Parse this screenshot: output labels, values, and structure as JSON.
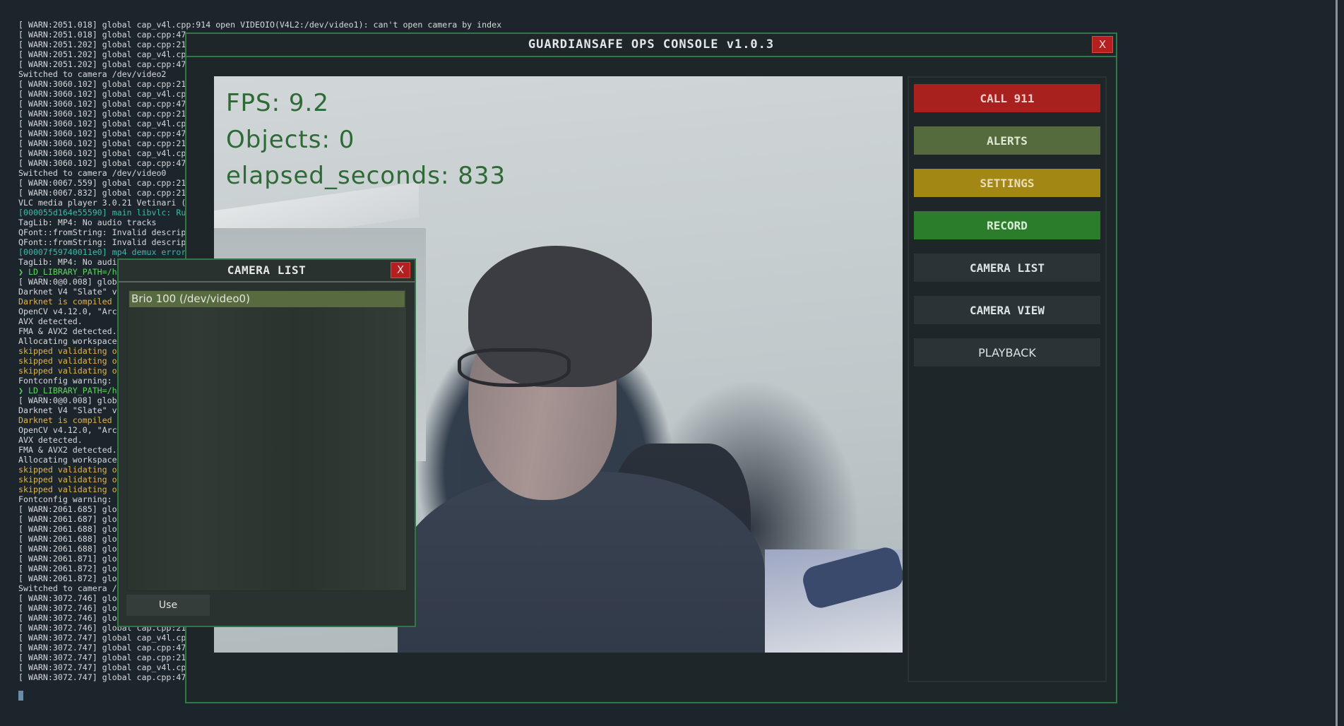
{
  "terminal": {
    "lines": [
      {
        "text": "[ WARN:2051.018] global cap_v4l.cpp:914 open VIDEOIO(V4L2:/dev/video1): can't open camera by index",
        "tone": "normal"
      },
      {
        "text": "[ WARN:2051.018] global cap.cpp:47",
        "tone": "normal"
      },
      {
        "text": "[ WARN:2051.202] global cap.cpp:21",
        "tone": "normal"
      },
      {
        "text": "[ WARN:2051.202] global cap_v4l.cp",
        "tone": "normal"
      },
      {
        "text": "[ WARN:2051.202] global cap.cpp:47",
        "tone": "normal"
      },
      {
        "text": "Switched to camera /dev/video2",
        "tone": "normal"
      },
      {
        "text": "[ WARN:3060.102] global cap.cpp:21",
        "tone": "normal"
      },
      {
        "text": "[ WARN:3060.102] global cap_v4l.cp",
        "tone": "normal"
      },
      {
        "text": "[ WARN:3060.102] global cap.cpp:47",
        "tone": "normal"
      },
      {
        "text": "[ WARN:3060.102] global cap.cpp:21",
        "tone": "normal"
      },
      {
        "text": "[ WARN:3060.102] global cap_v4l.cp",
        "tone": "normal"
      },
      {
        "text": "[ WARN:3060.102] global cap.cpp:47",
        "tone": "normal"
      },
      {
        "text": "[ WARN:3060.102] global cap.cpp:21",
        "tone": "normal"
      },
      {
        "text": "[ WARN:3060.102] global cap_v4l.cp",
        "tone": "normal"
      },
      {
        "text": "[ WARN:3060.102] global cap.cpp:47",
        "tone": "normal"
      },
      {
        "text": "Switched to camera /dev/video0",
        "tone": "normal"
      },
      {
        "text": "[ WARN:0067.559] global cap.cpp:21",
        "tone": "normal"
      },
      {
        "text": "[ WARN:0067.832] global cap.cpp:21",
        "tone": "normal"
      },
      {
        "text": "VLC media player 3.0.21 Vetinari (",
        "tone": "normal"
      },
      {
        "text": "[000055d164e55590] main libvlc: Ru",
        "tone": "addr"
      },
      {
        "text": "TagLib: MP4: No audio tracks",
        "tone": "normal"
      },
      {
        "text": "QFont::fromString: Invalid descrip",
        "tone": "normal"
      },
      {
        "text": "QFont::fromString: Invalid descrip",
        "tone": "normal"
      },
      {
        "text": "[00007f59740011e0] mp4 demux error",
        "tone": "addr"
      },
      {
        "text": "TagLib: MP4: No audio tracks",
        "tone": "normal"
      },
      {
        "text": "❯ LD_LIBRARY_PATH=/h",
        "tone": "green"
      },
      {
        "text": "[ WARN:0@0.008] glob",
        "tone": "normal"
      },
      {
        "text": "Darknet V4 \"Slate\" v",
        "tone": "normal"
      },
      {
        "text": "Darknet is compiled",
        "tone": "yellow"
      },
      {
        "text": "OpenCV v4.12.0, \"Arc",
        "tone": "normal"
      },
      {
        "text": "AVX detected.",
        "tone": "normal"
      },
      {
        "text": "FMA & AVX2 detected.",
        "tone": "normal"
      },
      {
        "text": "Allocating workspace",
        "tone": "normal"
      },
      {
        "text": "skipped validating o",
        "tone": "yellow"
      },
      {
        "text": "skipped validating o",
        "tone": "yellow"
      },
      {
        "text": "skipped validating o",
        "tone": "yellow"
      },
      {
        "text": "Fontconfig warning:",
        "tone": "normal"
      },
      {
        "text": "❯ LD_LIBRARY_PATH=/h",
        "tone": "green"
      },
      {
        "text": "[ WARN:0@0.008] glob",
        "tone": "normal"
      },
      {
        "text": "Darknet V4 \"Slate\" v",
        "tone": "normal"
      },
      {
        "text": "Darknet is compiled",
        "tone": "yellow"
      },
      {
        "text": "OpenCV v4.12.0, \"Arc",
        "tone": "normal"
      },
      {
        "text": "AVX detected.",
        "tone": "normal"
      },
      {
        "text": "FMA & AVX2 detected.",
        "tone": "normal"
      },
      {
        "text": "Allocating workspace",
        "tone": "normal"
      },
      {
        "text": "skipped validating o",
        "tone": "yellow"
      },
      {
        "text": "skipped validating o",
        "tone": "yellow"
      },
      {
        "text": "skipped validating o",
        "tone": "yellow"
      },
      {
        "text": "Fontconfig warning:",
        "tone": "normal"
      },
      {
        "text": "[ WARN:2061.685] glo",
        "tone": "normal"
      },
      {
        "text": "[ WARN:2061.687] glo",
        "tone": "normal"
      },
      {
        "text": "[ WARN:2061.688] glo",
        "tone": "normal"
      },
      {
        "text": "[ WARN:2061.688] glo",
        "tone": "normal"
      },
      {
        "text": "[ WARN:2061.688] glo",
        "tone": "normal"
      },
      {
        "text": "[ WARN:2061.871] glo",
        "tone": "normal"
      },
      {
        "text": "[ WARN:2061.872] glo",
        "tone": "normal"
      },
      {
        "text": "[ WARN:2061.872] glo",
        "tone": "normal"
      },
      {
        "text": "Switched to camera /",
        "tone": "normal"
      },
      {
        "text": "[ WARN:3072.746] glo",
        "tone": "normal"
      },
      {
        "text": "[ WARN:3072.746] glo",
        "tone": "normal"
      },
      {
        "text": "[ WARN:3072.746] global cap.cpp:47",
        "tone": "normal"
      },
      {
        "text": "[ WARN:3072.746] global cap.cpp:21",
        "tone": "normal"
      },
      {
        "text": "[ WARN:3072.747] global cap_v4l.cp",
        "tone": "normal"
      },
      {
        "text": "[ WARN:3072.747] global cap.cpp:47",
        "tone": "normal"
      },
      {
        "text": "[ WARN:3072.747] global cap.cpp:21",
        "tone": "normal"
      },
      {
        "text": "[ WARN:3072.747] global cap_v4l.cp",
        "tone": "normal"
      },
      {
        "text": "[ WARN:3072.747] global cap.cpp:47",
        "tone": "normal"
      }
    ]
  },
  "console": {
    "title": "GUARDIANSAFE OPS CONSOLE v1.0.3",
    "close_label": "X",
    "overlay": {
      "fps": "FPS: 9.2",
      "objects": "Objects: 0",
      "elapsed": "elapsed_seconds: 833"
    },
    "buttons": {
      "call": "CALL 911",
      "alerts": "ALERTS",
      "settings": "SETTINGS",
      "record": "RECORD",
      "camera_list": "CAMERA LIST",
      "camera_view": "CAMERA VIEW",
      "playback": "PLAYBACK"
    }
  },
  "camera_dialog": {
    "title": "CAMERA LIST",
    "close_label": "X",
    "items": [
      "Brio 100 (/dev/video0)"
    ],
    "selected_index": 0,
    "use_label": "Use"
  },
  "colors": {
    "window_border": "#2f7a43",
    "call": "#a8211f",
    "alerts": "#556b3d",
    "settings": "#a38715",
    "record": "#2b7d2b",
    "neutral_button": "#2b3336",
    "overlay_text": "#2d6a35",
    "selected_item": "#586a40"
  }
}
